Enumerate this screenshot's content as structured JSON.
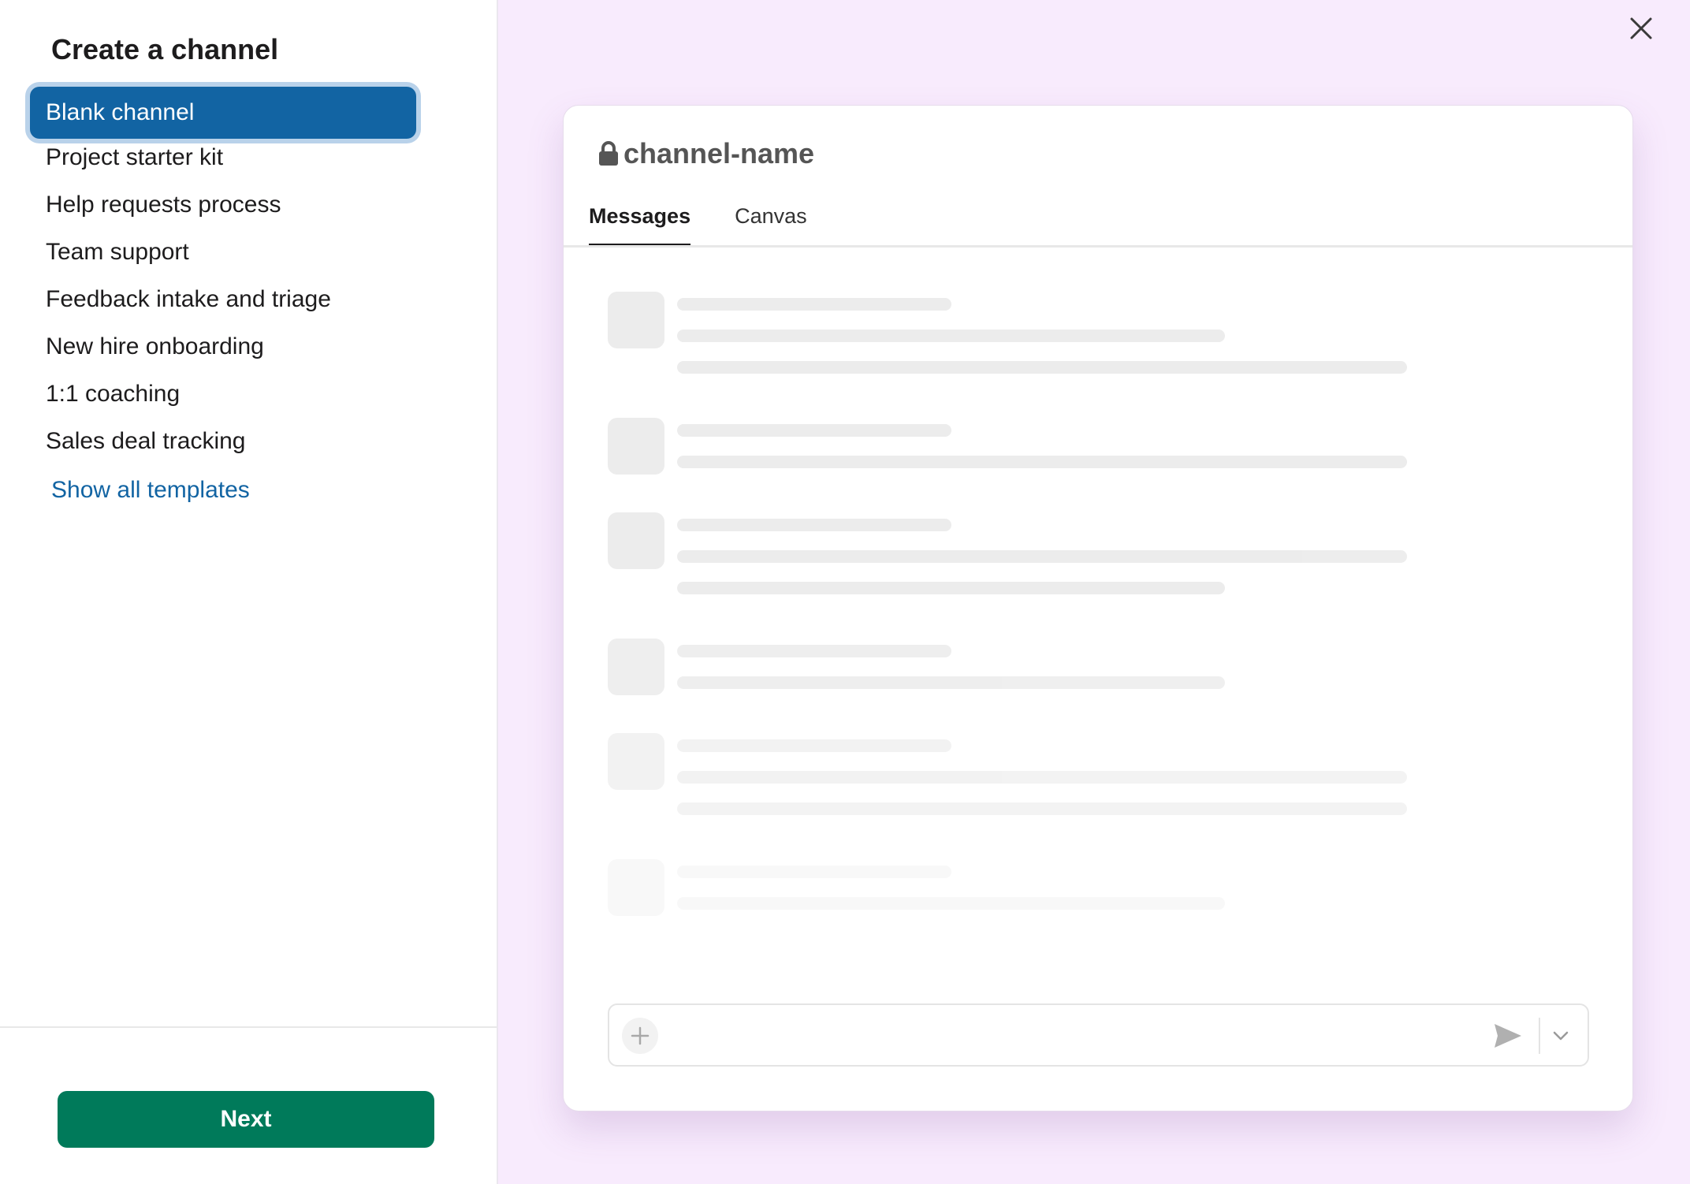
{
  "modal": {
    "title": "Create a channel"
  },
  "templates": {
    "items": [
      {
        "label": "Blank channel"
      },
      {
        "label": "Project starter kit"
      },
      {
        "label": "Help requests process"
      },
      {
        "label": "Team support"
      },
      {
        "label": "Feedback intake and triage"
      },
      {
        "label": "New hire onboarding"
      },
      {
        "label": "1:1 coaching"
      },
      {
        "label": "Sales deal tracking"
      }
    ],
    "selected": "Blank channel",
    "show_all_label": "Show all templates"
  },
  "footer": {
    "next_label": "Next"
  },
  "preview": {
    "channel_name": "channel-name",
    "tabs": [
      {
        "label": "Messages",
        "active": true
      },
      {
        "label": "Canvas",
        "active": false
      }
    ]
  },
  "icons": {
    "close": "close-icon",
    "lock": "lock-icon",
    "add": "plus-icon",
    "send": "send-icon",
    "options": "chevron-down-icon"
  },
  "colors": {
    "selected_bg": "#1264a3",
    "link": "#1264a3",
    "primary_button": "#007a5a",
    "right_bg": "#f8ebfd"
  }
}
